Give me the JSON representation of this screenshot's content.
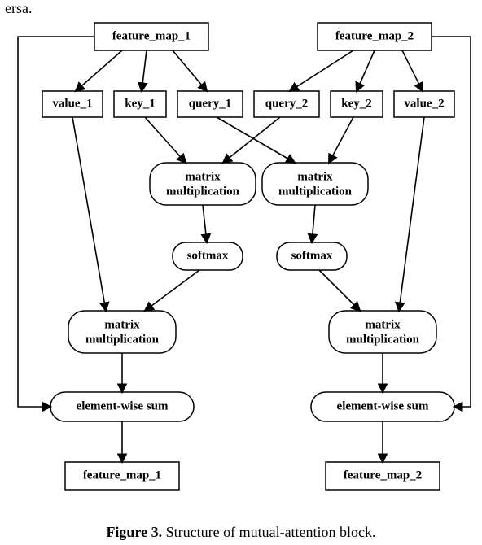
{
  "stray_text": "ersa.",
  "nodes": {
    "fm1": "feature_map_1",
    "fm2": "feature_map_2",
    "v1": "value_1",
    "k1": "key_1",
    "q1": "query_1",
    "q2": "query_2",
    "k2": "key_2",
    "v2": "value_2",
    "mm_l1": "matrix",
    "mm_l2": "multiplication",
    "mm_r1": "matrix",
    "mm_r2": "multiplication",
    "sm_l": "softmax",
    "sm_r": "softmax",
    "mm_bl1": "matrix",
    "mm_bl2": "multiplication",
    "mm_br1": "matrix",
    "mm_br2": "multiplication",
    "ews_l": "element-wise sum",
    "ews_r": "element-wise sum",
    "out1": "feature_map_1",
    "out2": "feature_map_2"
  },
  "caption_bold": "Figure 3.",
  "caption_rest": " Structure of mutual-attention block."
}
